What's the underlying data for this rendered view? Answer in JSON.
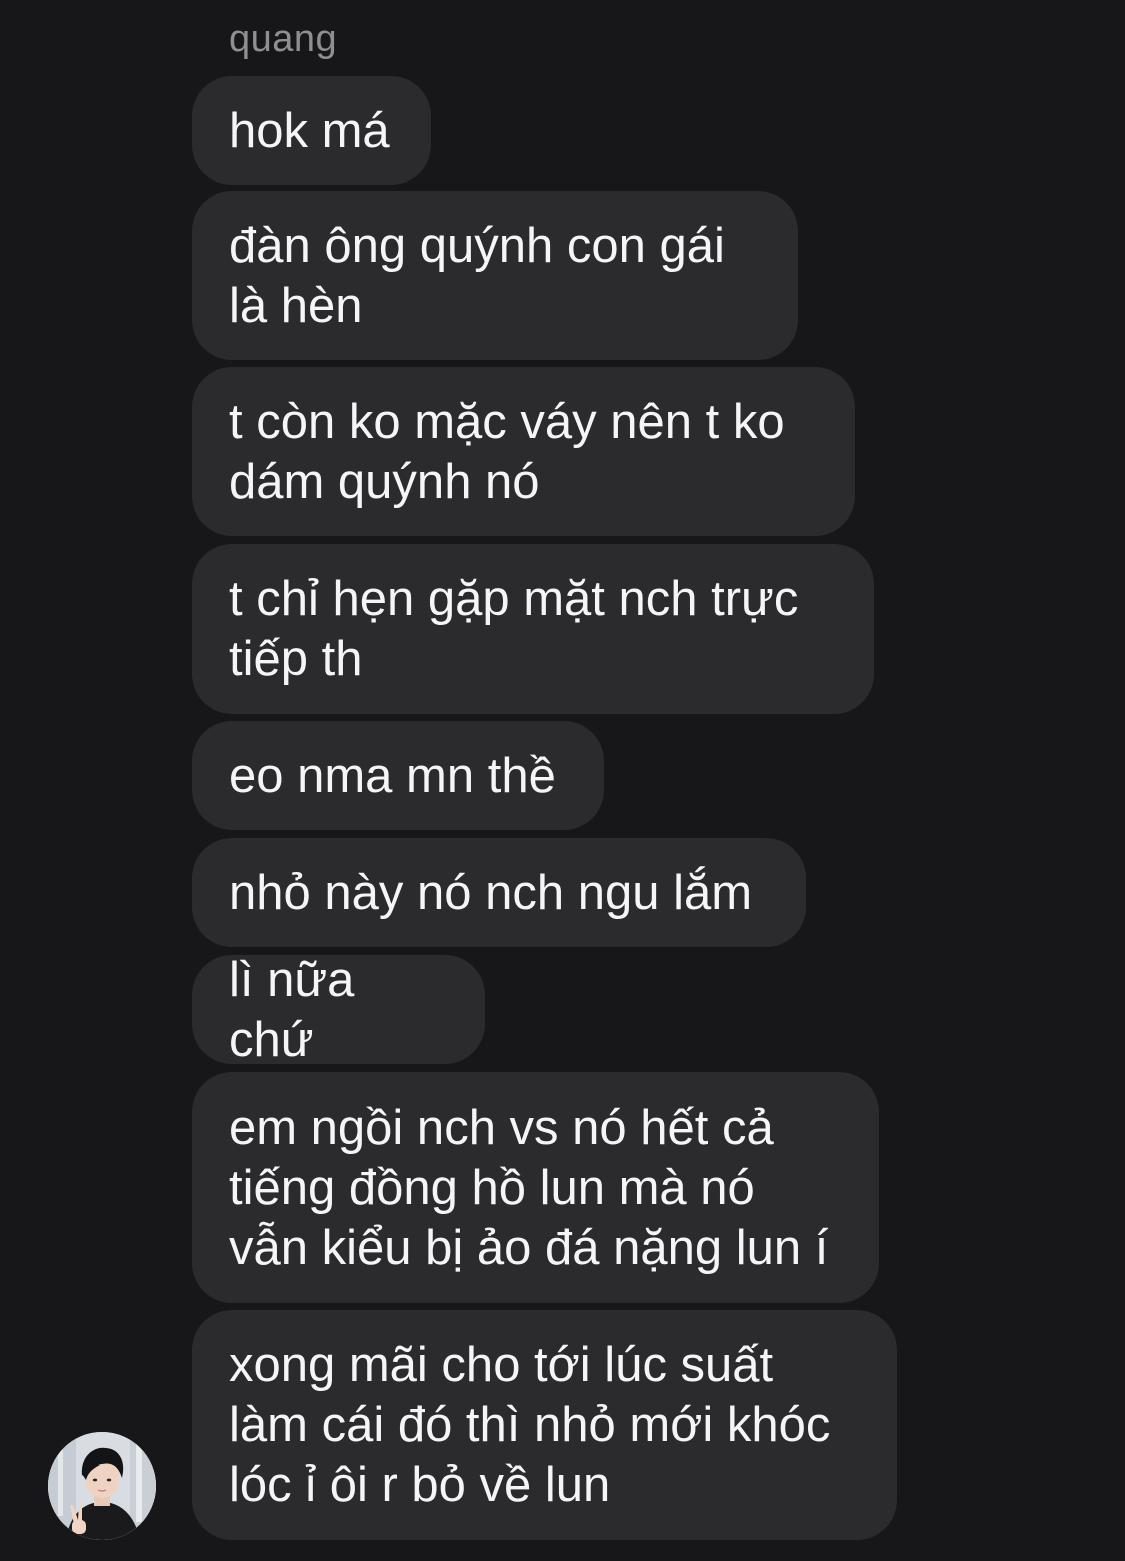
{
  "chat": {
    "sender_name": "quang",
    "messages": [
      {
        "text": "hok má"
      },
      {
        "text": "đàn ông quýnh con gái\nlà hèn"
      },
      {
        "text": "t còn ko mặc váy nên t ko\ndám quýnh nó"
      },
      {
        "text": "t chỉ hẹn gặp mặt nch trực\ntiếp th"
      },
      {
        "text": "eo nma mn thề"
      },
      {
        "text": "nhỏ này nó nch ngu lắm"
      },
      {
        "text": "lì nữa chứ"
      },
      {
        "text": "em ngồi nch vs nó hết cả\ntiếng đồng hồ lun mà nó\nvẫn kiểu bị ảo đá nặng lun í"
      },
      {
        "text": "xong mãi cho tới lúc suất\nlàm cái đó thì nhỏ mới khóc\nlóc ỉ ôi r bỏ về lun"
      }
    ]
  },
  "colors": {
    "background": "#17171a",
    "bubble": "#2b2b2e",
    "text": "#f5f5f7",
    "sender": "#8e8e93"
  },
  "avatar": {
    "icon": "user-avatar-photo"
  }
}
